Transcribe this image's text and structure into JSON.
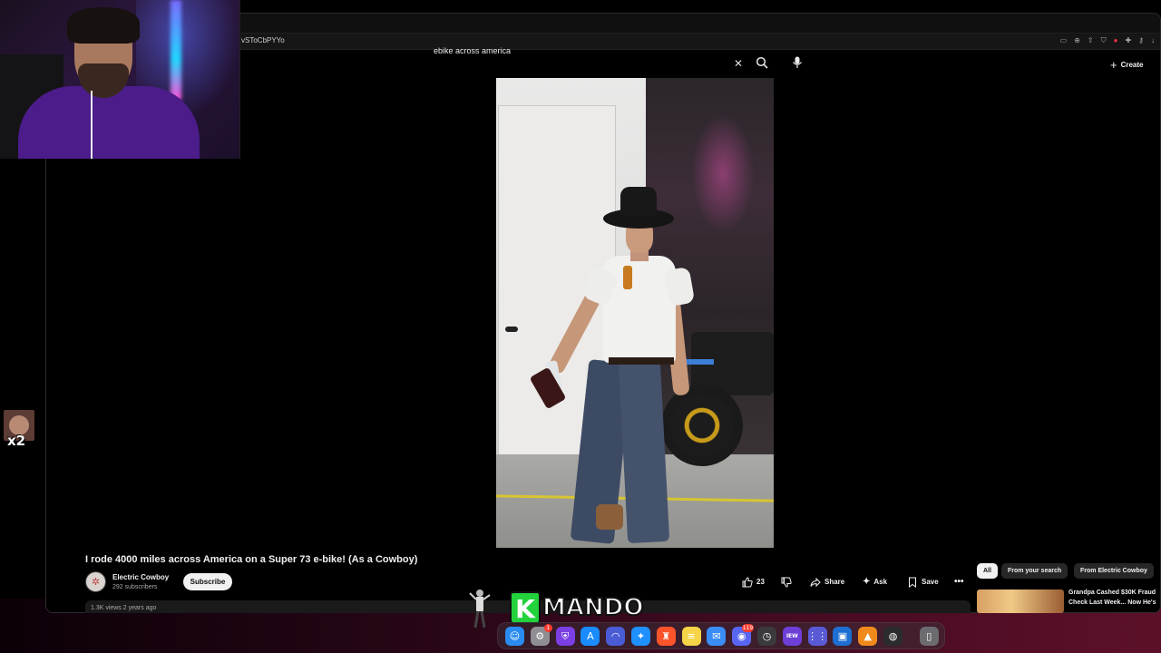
{
  "browser": {
    "url_fragment": "vSToCbPYYo",
    "toolbar_icons": [
      "cast-icon",
      "zoom-icon",
      "share-icon",
      "shield-icon",
      "extension-icon",
      "puzzle-icon",
      "key-icon",
      "download-icon"
    ]
  },
  "search": {
    "query": "ebike across america",
    "clear_icon": "close-icon",
    "search_icon": "search-icon",
    "mic_icon": "microphone-icon"
  },
  "header": {
    "create_label": "Create"
  },
  "video": {
    "title": "I rode 4000 miles across America on a Super 73 e-bike! (As a Cowboy)",
    "channel_name": "Electric Cowboy",
    "subscribers": "292 subscribers",
    "subscribe_label": "Subscribe",
    "meta": "1.3K views  2 years ago",
    "like_count": "23",
    "share_label": "Share",
    "ask_label": "Ask",
    "save_label": "Save"
  },
  "sidebar_chips": [
    "All",
    "From your search",
    "From Electric Cowboy"
  ],
  "recommendation": {
    "title_line1": "Grandpa Cashed $30K Fraud",
    "title_line2": "Check Last Week... Now He's"
  },
  "overlay": {
    "reaction_multiplier": "x2",
    "logo_k": "K",
    "logo_text": "MANDO"
  },
  "dock": {
    "apps": [
      {
        "name": "finder-icon",
        "color": "#2b8cf0",
        "glyph": "☺",
        "badge": ""
      },
      {
        "name": "settings-icon",
        "color": "#8e8e93",
        "glyph": "⚙",
        "badge": "1"
      },
      {
        "name": "vpn-shield-icon",
        "color": "#7b3fe4",
        "glyph": "⛨",
        "badge": ""
      },
      {
        "name": "app-store-icon",
        "color": "#1a8cff",
        "glyph": "A",
        "badge": ""
      },
      {
        "name": "arc-browser-icon",
        "color": "#4a5bd6",
        "glyph": "◠",
        "badge": ""
      },
      {
        "name": "safari-icon",
        "color": "#1e90ff",
        "glyph": "✦",
        "badge": ""
      },
      {
        "name": "brave-icon",
        "color": "#fb542b",
        "glyph": "♜",
        "badge": ""
      },
      {
        "name": "notes-icon",
        "color": "#f5d547",
        "glyph": "≡",
        "badge": ""
      },
      {
        "name": "mail-icon",
        "color": "#3a8df5",
        "glyph": "✉",
        "badge": ""
      },
      {
        "name": "discord-icon",
        "color": "#5865f2",
        "glyph": "◉",
        "badge": "119"
      },
      {
        "name": "activity-monitor-icon",
        "color": "#3a3a3c",
        "glyph": "◷",
        "badge": ""
      },
      {
        "name": "iew-app-icon",
        "color": "#6e3fd6",
        "glyph": "IEW",
        "badge": ""
      },
      {
        "name": "launchpad-icon",
        "color": "#5a5ad6",
        "glyph": "⋮⋮",
        "badge": ""
      },
      {
        "name": "capture-app-icon",
        "color": "#1d6fd1",
        "glyph": "▣",
        "badge": ""
      },
      {
        "name": "vlc-icon",
        "color": "#f08a1c",
        "glyph": "▲",
        "badge": ""
      },
      {
        "name": "obs-icon",
        "color": "#2c2c2e",
        "glyph": "◍",
        "badge": ""
      },
      {
        "name": "trash-icon",
        "color": "#6b6b70",
        "glyph": "▯",
        "badge": ""
      }
    ]
  }
}
